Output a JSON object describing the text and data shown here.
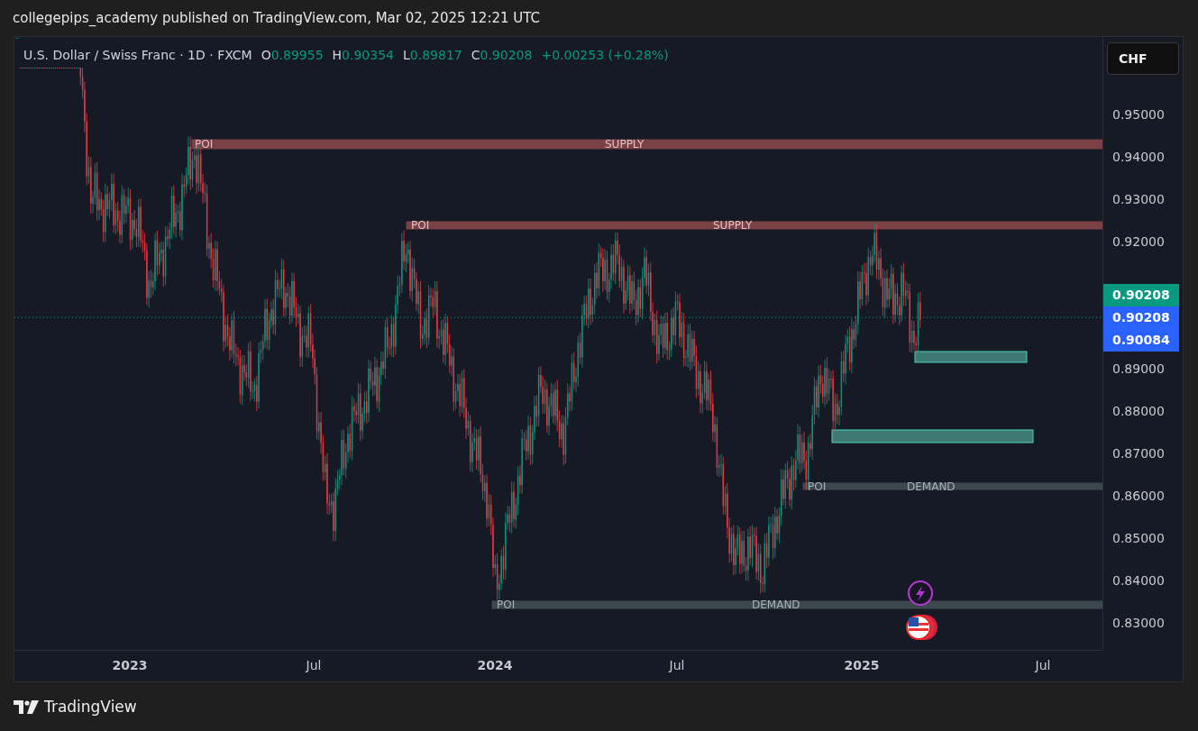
{
  "header": {
    "title": "collegepips_academy published on TradingView.com, Mar 02, 2025 12:21 UTC"
  },
  "legend": {
    "symbol": "U.S. Dollar / Swiss Franc · 1D · FXCM",
    "ohlc": [
      {
        "label": "O",
        "value": "0.89955"
      },
      {
        "label": "H",
        "value": "0.90354"
      },
      {
        "label": "L",
        "value": "0.89817"
      },
      {
        "label": "C",
        "value": "0.90208"
      }
    ],
    "change": "+0.00253 (+0.28%)"
  },
  "currency_button": "CHF",
  "zones": [
    {
      "kind": "supply",
      "labels": [
        "POI",
        "SUPPLY"
      ]
    },
    {
      "kind": "supply",
      "labels": [
        "POI",
        "SUPPLY"
      ]
    },
    {
      "kind": "box"
    },
    {
      "kind": "box"
    },
    {
      "kind": "demand",
      "labels": [
        "POI",
        "DEMAND"
      ]
    },
    {
      "kind": "demand",
      "labels": [
        "POI",
        "DEMAND"
      ]
    }
  ],
  "price_axis": [
    "0.95000",
    "0.94000",
    "0.93000",
    "0.92000",
    "0.89000",
    "0.88000",
    "0.87000",
    "0.86000",
    "0.85000",
    "0.84000",
    "0.83000"
  ],
  "price_tags": [
    {
      "text": "0.90208",
      "kind": "close"
    },
    {
      "text": "0.90208",
      "kind": "last"
    },
    {
      "text": "0.90084",
      "kind": "bid"
    }
  ],
  "time_axis": [
    {
      "text": "2023",
      "kind": "year"
    },
    {
      "text": "Jul",
      "kind": "month"
    },
    {
      "text": "2024",
      "kind": "year"
    },
    {
      "text": "Jul",
      "kind": "month"
    },
    {
      "text": "2025",
      "kind": "year"
    },
    {
      "text": "Jul",
      "kind": "month"
    }
  ],
  "footer": {
    "brand": "TradingView"
  }
}
